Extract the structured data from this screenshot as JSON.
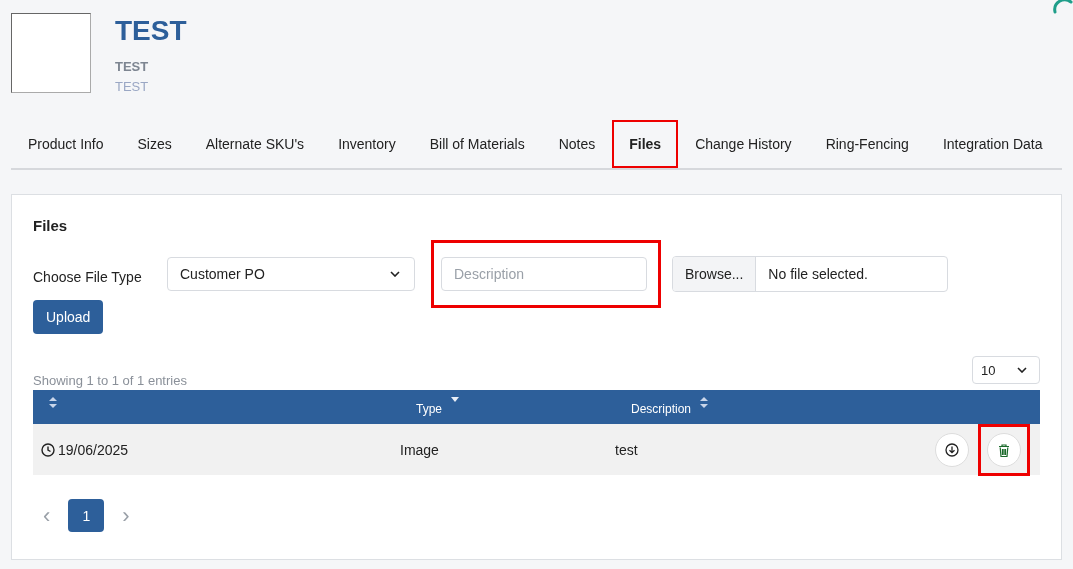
{
  "header": {
    "title": "TEST",
    "subtitle": "TEST",
    "caption": "TEST"
  },
  "tabs": [
    {
      "label": "Product Info",
      "selected": false,
      "highlighted": false
    },
    {
      "label": "Sizes",
      "selected": false,
      "highlighted": false
    },
    {
      "label": "Alternate SKU's",
      "selected": false,
      "highlighted": false
    },
    {
      "label": "Inventory",
      "selected": false,
      "highlighted": false
    },
    {
      "label": "Bill of Materials",
      "selected": false,
      "highlighted": false
    },
    {
      "label": "Notes",
      "selected": false,
      "highlighted": false
    },
    {
      "label": "Files",
      "selected": true,
      "highlighted": true
    },
    {
      "label": "Change History",
      "selected": false,
      "highlighted": false
    },
    {
      "label": "Ring-Fencing",
      "selected": false,
      "highlighted": false
    },
    {
      "label": "Integration Data",
      "selected": false,
      "highlighted": false
    }
  ],
  "upload_form": {
    "heading": "Files",
    "file_type_label": "Choose File Type",
    "file_type_value": "Customer PO",
    "description": {
      "placeholder": "Description",
      "highlighted": true
    },
    "browse_button": "Browse...",
    "file_status": "No file selected.",
    "upload_button": "Upload"
  },
  "table": {
    "info": "Showing 1 to 1 of 1 entries",
    "page_size": "10",
    "columns": [
      {
        "kind": "sortable"
      },
      {
        "label": "Type",
        "kind": "sorted"
      },
      {
        "label": "Description",
        "kind": "sortable"
      }
    ],
    "rows": [
      {
        "date": "19/06/2025",
        "type": "Image",
        "description": "test",
        "actions": [
          {
            "kind": "download",
            "highlighted": false
          },
          {
            "kind": "delete",
            "highlighted": true
          }
        ]
      }
    ]
  },
  "pagination": {
    "prev": "‹",
    "pages": [
      {
        "label": "1",
        "selected": true
      }
    ],
    "next": "›"
  }
}
